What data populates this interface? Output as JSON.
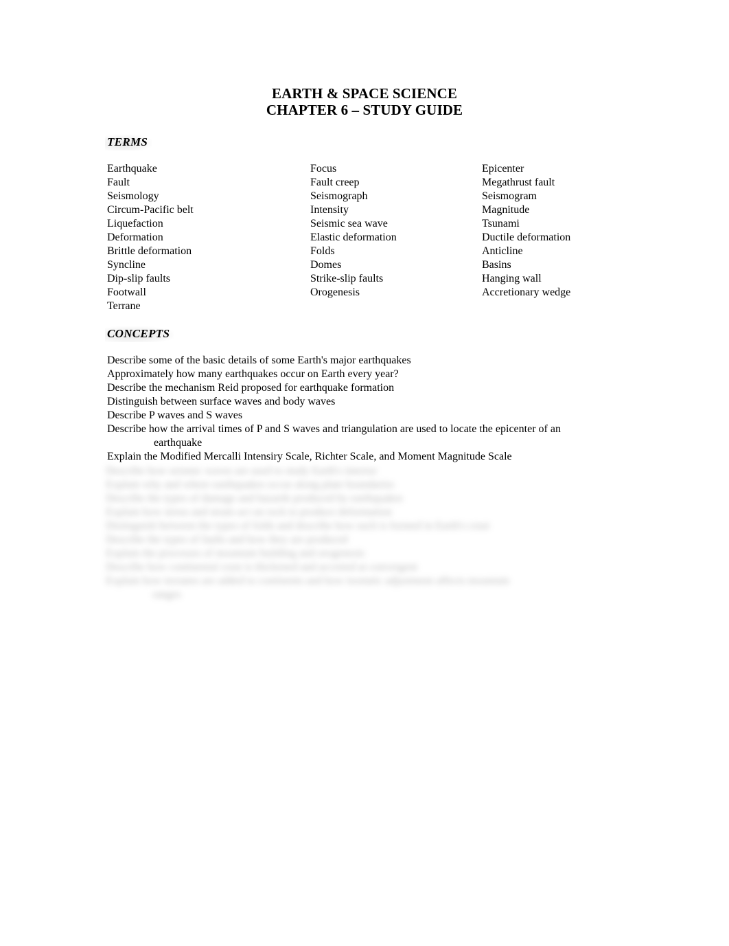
{
  "document": {
    "title_lines": [
      "EARTH & SPACE SCIENCE",
      "CHAPTER 6 – STUDY GUIDE"
    ]
  },
  "sections": {
    "terms": {
      "heading": "TERMS",
      "columns": [
        [
          "Earthquake",
          "Fault",
          "Seismology",
          "Circum-Pacific belt",
          "Liquefaction",
          "Deformation",
          "Brittle deformation",
          "Syncline",
          "Dip-slip faults",
          "Footwall",
          "Terrane"
        ],
        [
          "Focus",
          "Fault creep",
          "Seismograph",
          "Intensity",
          "Seismic sea wave",
          "Elastic deformation",
          "Folds",
          "Domes",
          "Strike-slip faults",
          "Orogenesis"
        ],
        [
          "Epicenter",
          "Megathrust fault",
          "Seismogram",
          "Magnitude",
          "Tsunami",
          "Ductile deformation",
          "Anticline",
          "Basins",
          "Hanging wall",
          "Accretionary wedge"
        ]
      ]
    },
    "concepts": {
      "heading": "CONCEPTS",
      "items": [
        {
          "text": "Describe some of the basic details of some Earth's major earthquakes",
          "continuation": ""
        },
        {
          "text": "Approximately how many earthquakes occur on Earth every year?",
          "continuation": ""
        },
        {
          "text": "Describe the mechanism Reid proposed for earthquake formation",
          "continuation": ""
        },
        {
          "text": "Distinguish between surface waves and body waves",
          "continuation": ""
        },
        {
          "text": "Describe P waves and S waves",
          "continuation": ""
        },
        {
          "text": "Describe how the arrival times of P and S waves and triangulation are used to locate the epicenter of an",
          "continuation": "earthquake"
        },
        {
          "text": "Explain the Modified Mercalli Intensiry Scale, Richter Scale, and Moment Magnitude Scale",
          "continuation": ""
        }
      ]
    },
    "obscured": {
      "note": "blurred preview text",
      "lines": [
        {
          "text": "Describe how seismic waves are used to study Earth's interior",
          "indent": false
        },
        {
          "text": "Explain why and where earthquakes occur along plate boundaries",
          "indent": false
        },
        {
          "text": "Describe the types of damage and hazards produced by earthquakes",
          "indent": false
        },
        {
          "text": "Explain how stress and strain act on rock to produce deformation",
          "indent": false
        },
        {
          "text": "Distinguish between the types of folds and describe how each is formed in Earth's crust",
          "indent": false
        },
        {
          "text": "Describe the types of faults and how they are produced",
          "indent": false
        },
        {
          "text": "Explain the processes of mountain building and orogenesis",
          "indent": false
        },
        {
          "text": "Describe how continental crust is thickened and accreted at convergent",
          "indent": false
        },
        {
          "text": "Explain how terranes are added to continents and how isostatic adjustment affects mountain",
          "indent": false
        },
        {
          "text": "ranges",
          "indent": true
        }
      ]
    }
  }
}
